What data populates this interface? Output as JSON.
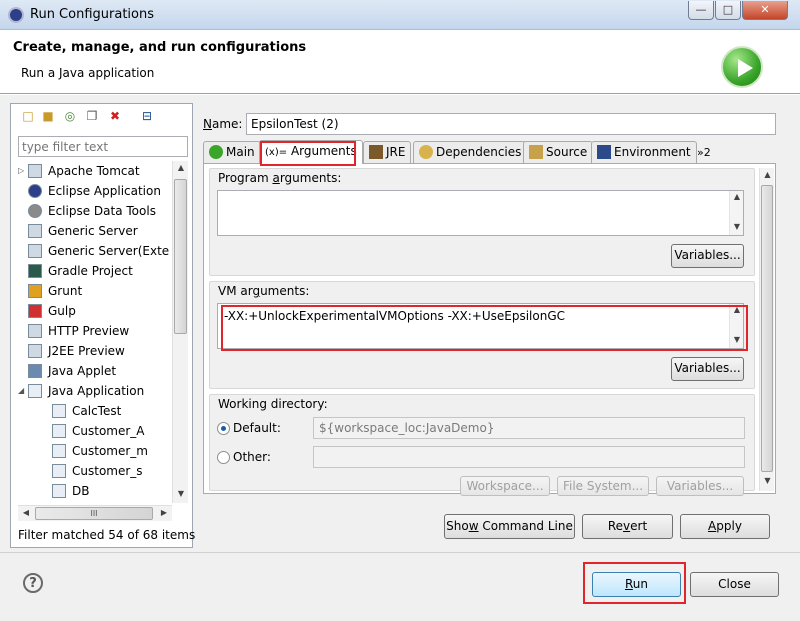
{
  "window": {
    "title": "Run Configurations",
    "minimize": "—",
    "maximize": "□",
    "close": "✕"
  },
  "header": {
    "title": "Create, manage, and run configurations",
    "subtitle": "Run a Java application"
  },
  "left": {
    "filter_placeholder": "type filter text",
    "status": "Filter matched 54 of 68 items",
    "tree": [
      {
        "label": "Apache Tomcat",
        "icon": "server-icon",
        "level": 1,
        "expander": "▷"
      },
      {
        "label": "Eclipse Application",
        "icon": "eclipse-icon",
        "level": 1,
        "expander": ""
      },
      {
        "label": "Eclipse Data Tools",
        "icon": "database-icon",
        "level": 1,
        "expander": ""
      },
      {
        "label": "Generic Server",
        "icon": "server-icon",
        "level": 1,
        "expander": ""
      },
      {
        "label": "Generic Server(Exte",
        "icon": "server-icon",
        "level": 1,
        "expander": ""
      },
      {
        "label": "Gradle Project",
        "icon": "gradle-icon",
        "level": 1,
        "expander": ""
      },
      {
        "label": "Grunt",
        "icon": "grunt-icon",
        "level": 1,
        "expander": ""
      },
      {
        "label": "Gulp",
        "icon": "gulp-icon",
        "level": 1,
        "expander": ""
      },
      {
        "label": "HTTP Preview",
        "icon": "server-icon",
        "level": 1,
        "expander": ""
      },
      {
        "label": "J2EE Preview",
        "icon": "server-icon",
        "level": 1,
        "expander": ""
      },
      {
        "label": "Java Applet",
        "icon": "applet-icon",
        "level": 1,
        "expander": ""
      },
      {
        "label": "Java Application",
        "icon": "java-app-icon",
        "level": 1,
        "expander": "◢"
      },
      {
        "label": "CalcTest",
        "icon": "java-app-icon",
        "level": 2,
        "expander": ""
      },
      {
        "label": "Customer_A",
        "icon": "java-app-icon",
        "level": 2,
        "expander": ""
      },
      {
        "label": "Customer_m",
        "icon": "java-app-icon",
        "level": 2,
        "expander": ""
      },
      {
        "label": "Customer_s",
        "icon": "java-app-icon",
        "level": 2,
        "expander": ""
      },
      {
        "label": "DB",
        "icon": "java-app-icon",
        "level": 2,
        "expander": ""
      }
    ],
    "scroll_h_grip": "III"
  },
  "right": {
    "name_label": "Name:",
    "name_value": "EpsilonTest (2)",
    "tabs": [
      {
        "label": "Main",
        "icon": "main-icon"
      },
      {
        "label": "Arguments",
        "icon": "arguments-icon",
        "prefix": "(x)="
      },
      {
        "label": "JRE",
        "icon": "jre-icon"
      },
      {
        "label": "Dependencies",
        "icon": "dependencies-icon"
      },
      {
        "label": "Source",
        "icon": "source-icon"
      },
      {
        "label": "Environment",
        "icon": "environment-icon"
      }
    ],
    "tab_overflow": "»2",
    "program_args_label": "Program arguments:",
    "program_args_value": "",
    "variables_label": "Variables...",
    "vm_args_label": "VM arguments:",
    "vm_args_value": "-XX:+UnlockExperimentalVMOptions -XX:+UseEpsilonGC",
    "working_dir_label": "Working directory:",
    "default_label": "Default:",
    "default_value": "${workspace_loc:JavaDemo}",
    "other_label": "Other:",
    "other_value": "",
    "workspace_btn": "Workspace...",
    "filesystem_btn": "File System...",
    "wd_variables_btn": "Variables...",
    "show_cmd_btn": "Show Command Line",
    "revert_btn": "Revert",
    "apply_btn": "Apply"
  },
  "footer": {
    "help": "?",
    "run_btn": "Run",
    "close_btn": "Close"
  },
  "colors": {
    "highlight": "#e0262a",
    "accent": "#3aa52a"
  }
}
